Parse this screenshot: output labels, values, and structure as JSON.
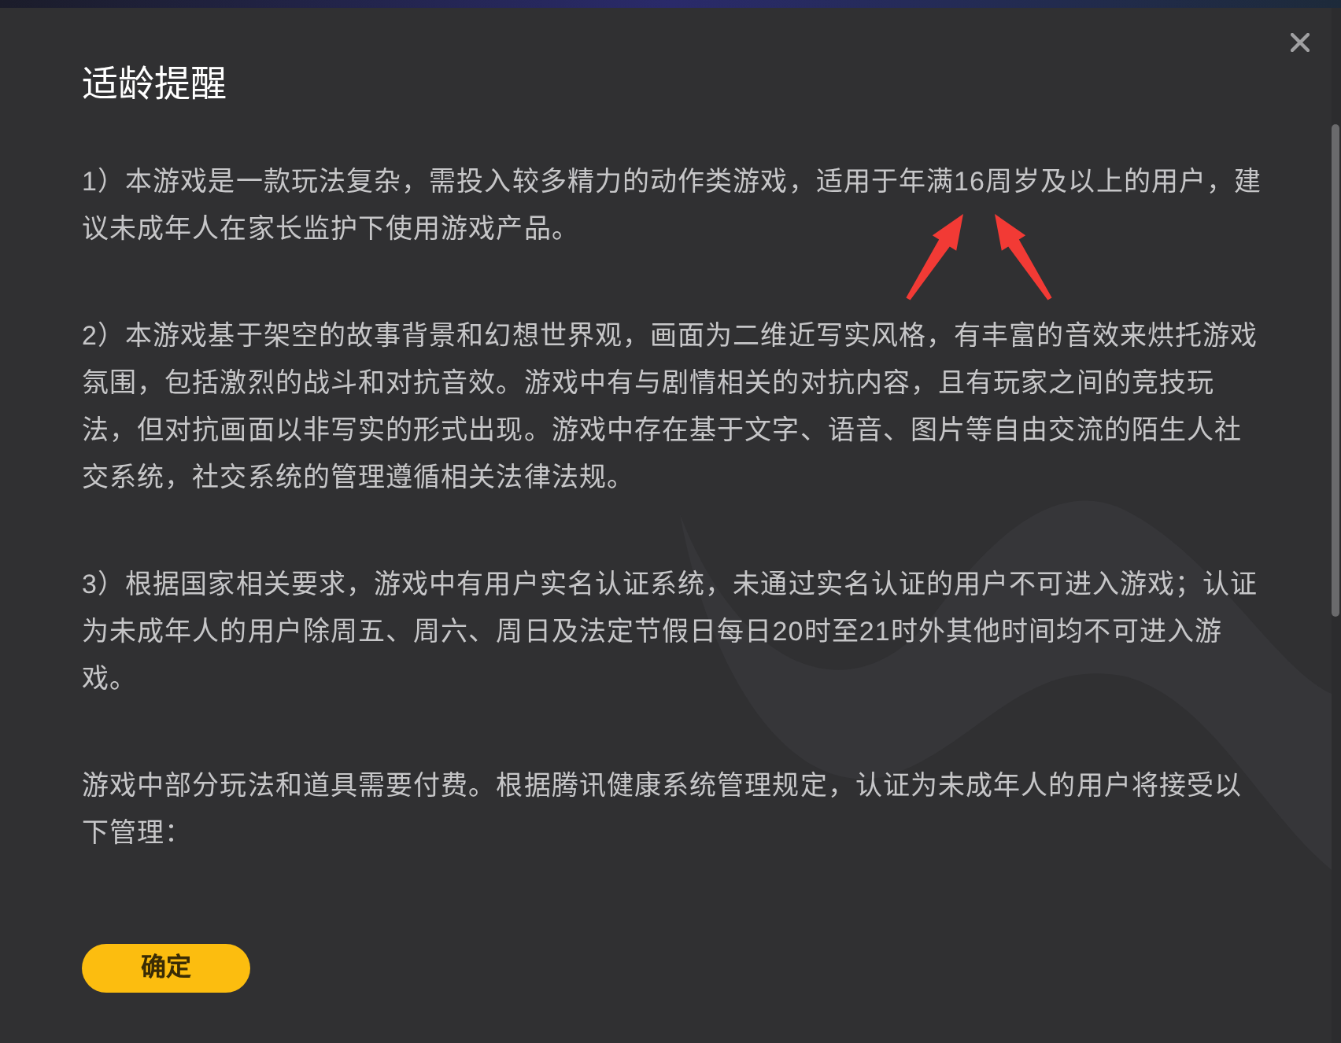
{
  "dialog": {
    "title": "适龄提醒",
    "paragraphs": [
      "1）本游戏是一款玩法复杂，需投入较多精力的动作类游戏，适用于年满16周岁及以上的用户，建议未成年人在家长监护下使用游戏产品。",
      "2）本游戏基于架空的故事背景和幻想世界观，画面为二维近写实风格，有丰富的音效来烘托游戏氛围，包括激烈的战斗和对抗音效。游戏中有与剧情相关的对抗内容，且有玩家之间的竞技玩法，但对抗画面以非写实的形式出现。游戏中存在基于文字、语音、图片等自由交流的陌生人社交系统，社交系统的管理遵循相关法律法规。",
      "3）根据国家相关要求，游戏中有用户实名认证系统，未通过实名认证的用户不可进入游戏；认证为未成年人的用户除周五、周六、周日及法定节假日每日20时至21时外其他时间均不可进入游戏。",
      "游戏中部分玩法和道具需要付费。根据腾讯健康系统管理规定，认证为未成年人的用户将接受以下管理："
    ],
    "confirm_button": "确定"
  }
}
